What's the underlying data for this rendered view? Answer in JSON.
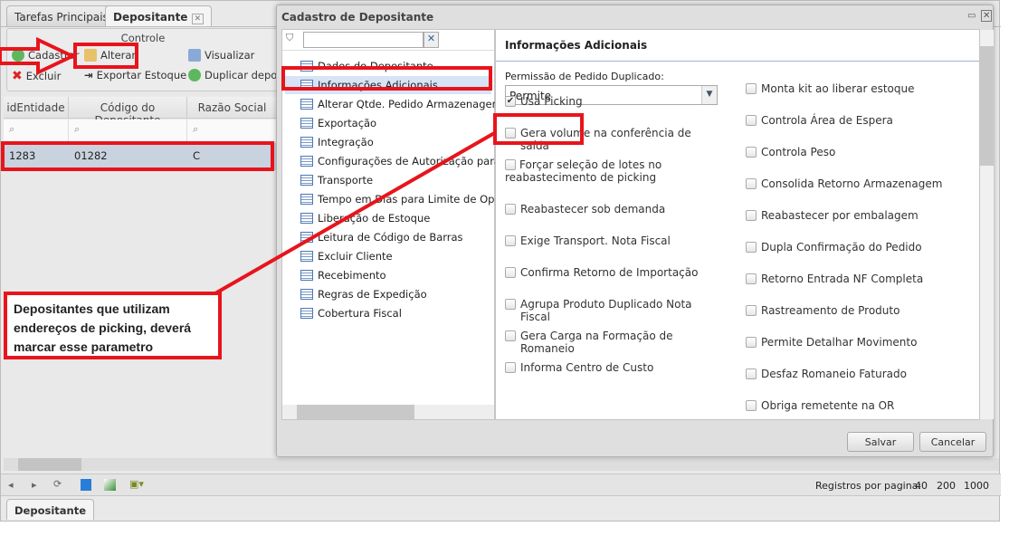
{
  "tabs": [
    {
      "label": "Tarefas Principais"
    },
    {
      "label": "Depositante"
    }
  ],
  "toolbar": {
    "group_title": "Controle",
    "cadastrar": "Cadastrar",
    "alterar": "Alterar",
    "visualizar": "Visualizar",
    "excluir": "Excluir",
    "exportar": "Exportar Estoque",
    "duplicar": "Duplicar depositante"
  },
  "grid": {
    "columns": [
      "idEntidade",
      "Código do Depositante",
      "Razão Social"
    ],
    "rows": [
      [
        "1283",
        "01282",
        "C"
      ]
    ]
  },
  "pager": {
    "label": "Registros por pagina:",
    "sizes": [
      "40",
      "200",
      "1000"
    ]
  },
  "bottom_tab": "Depositante",
  "dialog": {
    "title": "Cadastro de Depositante",
    "filter_value": "",
    "tree": [
      "Dados do Depositante",
      "Informações Adicionais",
      "Alterar Qtde. Pedido Armazenagem",
      "Exportação",
      "Integração",
      "Configurações de Autorização para Bloqueio",
      "Transporte",
      "Tempo em Dias para Limite de Operação",
      "Liberação de Estoque",
      "Leitura de Código de Barras",
      "Excluir Cliente",
      "Recebimento",
      "Regras de Expedição",
      "Cobertura Fiscal"
    ],
    "section_title": "Informações Adicionais",
    "select_label": "Permissão de Pedido Duplicado:",
    "select_value": "Permite",
    "left_checks": [
      {
        "label": "Usa Picking",
        "checked": true
      },
      {
        "label": "Gera volume na conferência de saída",
        "checked": false
      },
      {
        "label": "Forçar seleção de lotes no reabastecimento de picking",
        "checked": false
      },
      {
        "label": "Reabastecer sob demanda",
        "checked": false
      },
      {
        "label": "Exige Transport. Nota Fiscal",
        "checked": false
      },
      {
        "label": "Confirma Retorno de Importação",
        "checked": false
      },
      {
        "label": "Agrupa Produto Duplicado Nota Fiscal",
        "checked": false
      },
      {
        "label": "Gera Carga na Formação de Romaneio",
        "checked": false
      },
      {
        "label": "Informa Centro de Custo",
        "checked": false
      }
    ],
    "right_checks": [
      {
        "label": "Monta kit ao liberar estoque",
        "checked": false
      },
      {
        "label": "Controla Área de Espera",
        "checked": false
      },
      {
        "label": "Controla Peso",
        "checked": false
      },
      {
        "label": "Consolida Retorno Armazenagem",
        "checked": false
      },
      {
        "label": "Reabastecer por embalagem",
        "checked": false
      },
      {
        "label": "Dupla Confirmação do Pedido",
        "checked": false
      },
      {
        "label": "Retorno Entrada NF Completa",
        "checked": false
      },
      {
        "label": "Rastreamento de Produto",
        "checked": false
      },
      {
        "label": "Permite Detalhar Movimento",
        "checked": false
      },
      {
        "label": "Desfaz Romaneio Faturado",
        "checked": false
      },
      {
        "label": "Obriga remetente na OR",
        "checked": false
      }
    ],
    "save": "Salvar",
    "cancel": "Cancelar"
  },
  "annotation": {
    "text": "Depositantes que utilizam endereços de picking, deverá marcar esse parametro",
    "color": "#e8141c"
  }
}
